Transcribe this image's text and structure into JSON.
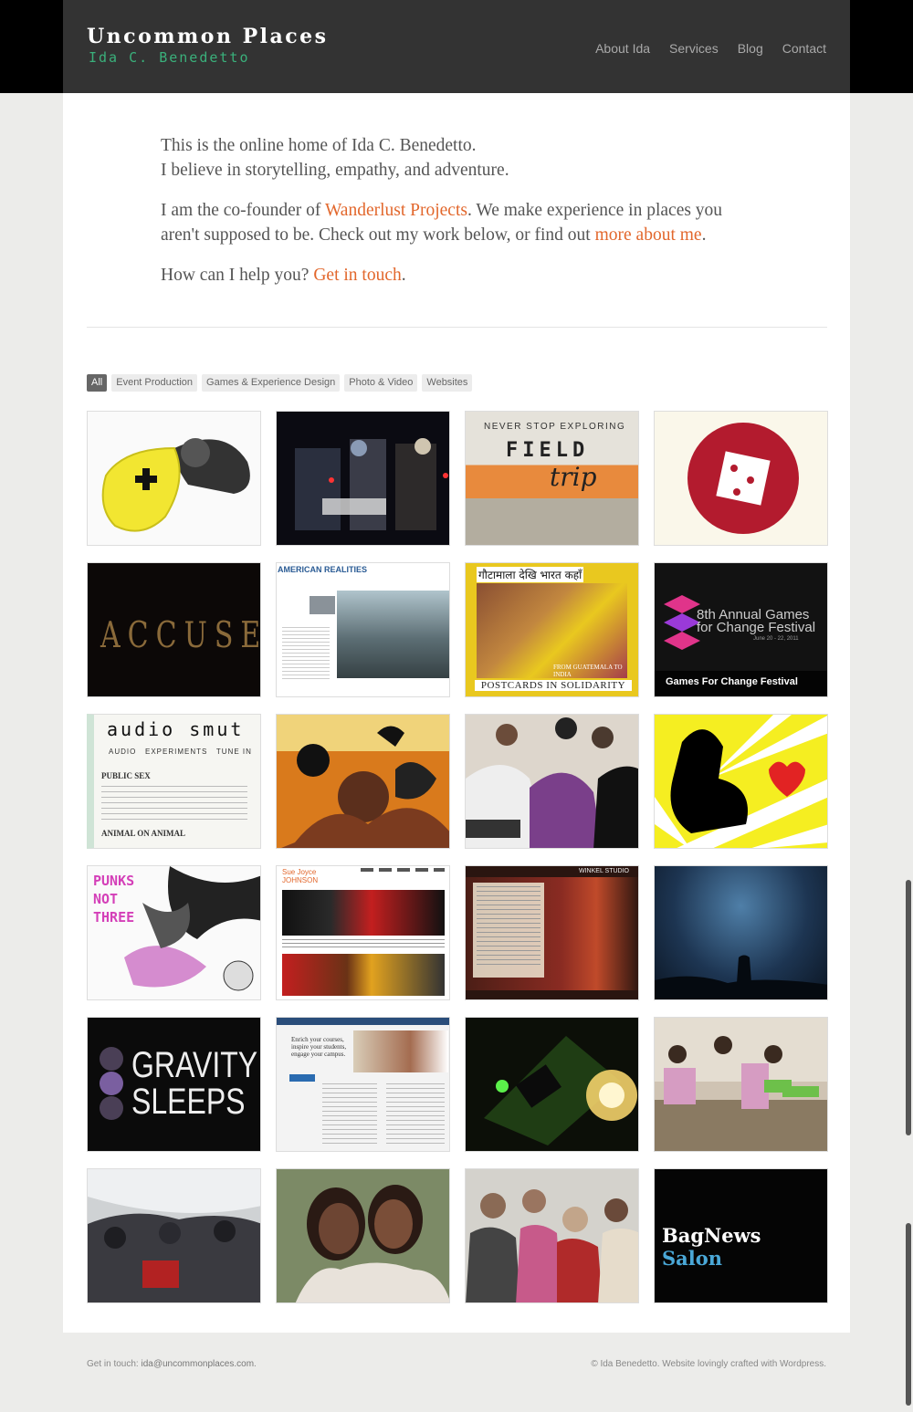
{
  "header": {
    "title": "Uncommon Places",
    "subtitle": "Ida C. Benedetto",
    "nav": [
      "About Ida",
      "Services",
      "Blog",
      "Contact"
    ]
  },
  "intro": {
    "line1": "This is the online home of Ida C. Benedetto.",
    "line2": "I believe in storytelling, empathy, and adventure.",
    "p2_pre": "I am the co-founder of ",
    "p2_link": "Wanderlust Projects",
    "p2_mid": ". We make experience in places you aren't supposed to be. Check out my work below, or find out ",
    "p2_link2": "more about me",
    "p2_end": ".",
    "p3_pre": "How can I help you? ",
    "p3_link": "Get in touch",
    "p3_end": "."
  },
  "filters": [
    "All",
    "Event Production",
    "Games & Experience Design",
    "Photo & Video",
    "Websites"
  ],
  "thumbs": {
    "field_trip_top": "NEVER STOP EXPLORING",
    "field_trip_title": "FIELD",
    "field_trip_sub": "trip",
    "american_realities": "AMERICAN REALITIES",
    "postcards_hindi": "गौटामाला देखि भारत कहाँ",
    "postcards_from": "FROM GUATEMALA TO INDIA",
    "postcards_title": "POSTCARDS IN SOLIDARITY",
    "accused": "ACCUSED",
    "g4c_title": "8th Annual Games for Change Festival",
    "g4c_date": "June 20 - 22, 2011",
    "g4c_caption": "Games For Change Festival",
    "audio_smut": "audio smut",
    "audio_nav": "AUDIO   EXPERIMENTS   TUNE IN",
    "audio_post1": "PUBLIC SEX",
    "audio_post2": "ANIMAL ON ANIMAL",
    "punks": "PUNKS NOT THREE",
    "sue_joyce": "Sue Joyce JOHNSON",
    "winkel": "WINKEL STUDIO",
    "gravity1": "GRAVITY",
    "gravity2": "SLEEPS",
    "enrich": "Enrich your courses, inspire your students, engage your campus.",
    "bagnews1": "BagNews",
    "bagnews2": "Salon"
  },
  "footer": {
    "left_pre": "Get in touch: ",
    "email": "ida@uncommonplaces.com",
    "left_end": ".",
    "right": "© Ida Benedetto. Website lovingly crafted with Wordpress."
  }
}
